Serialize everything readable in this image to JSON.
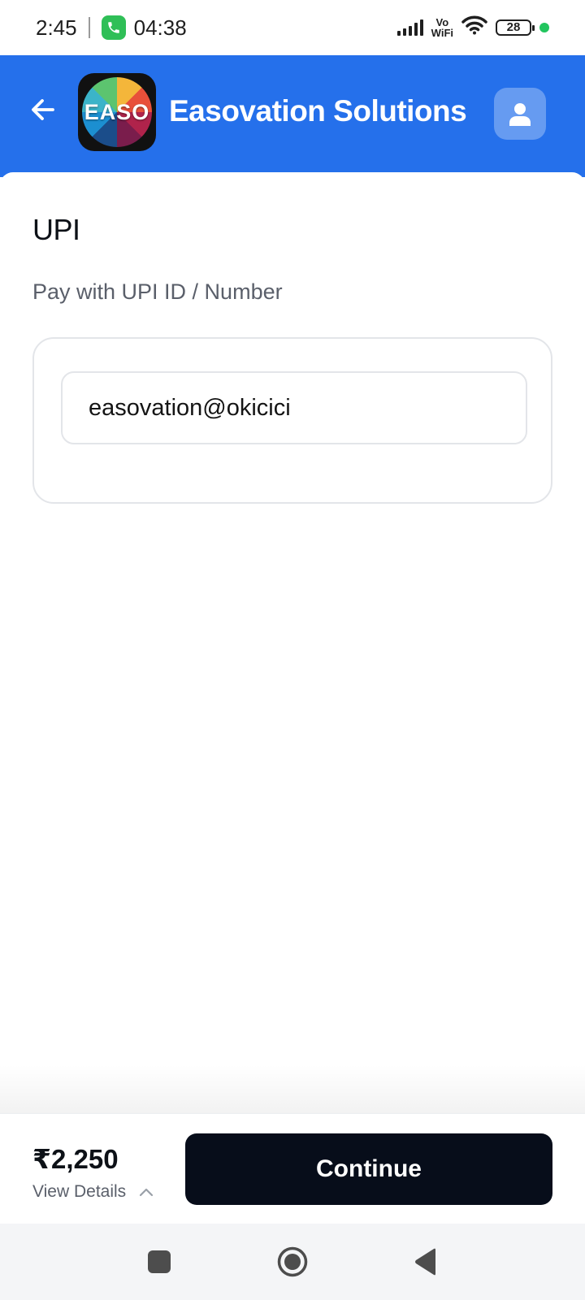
{
  "status_bar": {
    "time": "2:45",
    "call_timer": "04:38",
    "network_label_top": "Vo",
    "network_label_bottom": "WiFi",
    "battery": "28"
  },
  "header": {
    "logo_text": "EASO",
    "title": "Easovation Solutions"
  },
  "payment": {
    "section_title": "UPI",
    "subtitle": "Pay with UPI ID / Number",
    "upi_value": "easovation@okicici"
  },
  "footer": {
    "amount": "₹2,250",
    "view_details_label": "View Details",
    "continue_label": "Continue"
  },
  "colors": {
    "header_bg": "#2570eb",
    "button_bg": "#070d1a",
    "status_dot": "#22c55e"
  },
  "icons": {
    "back": "arrow-left-icon",
    "profile": "user-icon",
    "details": "chevron-up-icon",
    "nav_recents": "square-icon",
    "nav_home": "circle-icon",
    "nav_back": "triangle-back-icon"
  }
}
